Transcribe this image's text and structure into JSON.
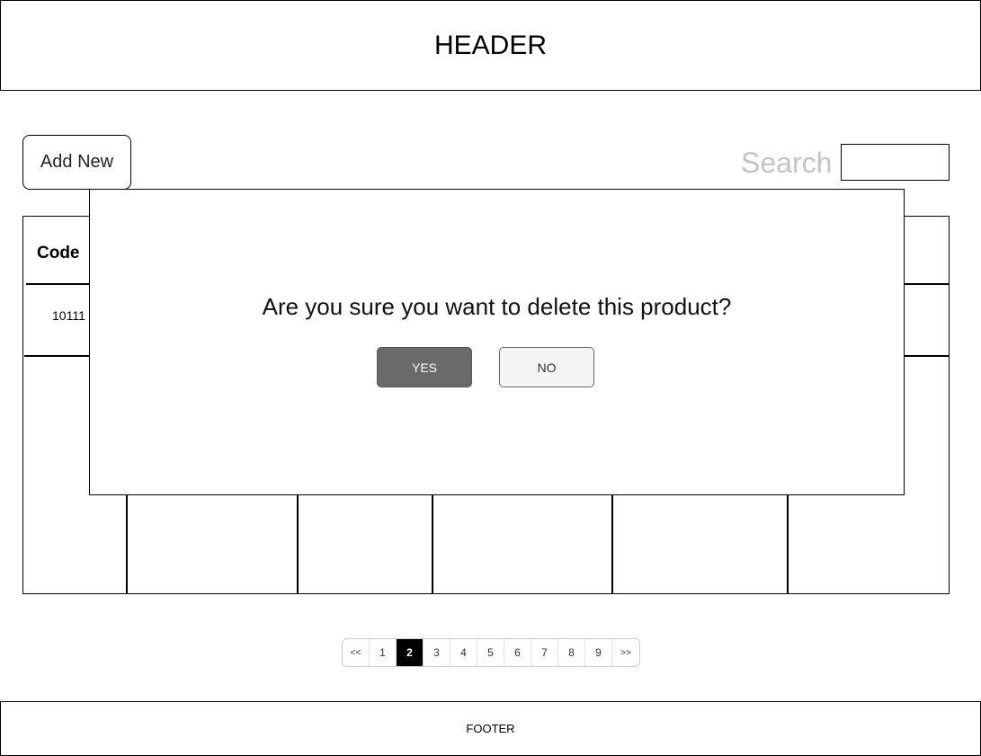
{
  "header": {
    "title": "HEADER"
  },
  "toolbar": {
    "add_new_label": "Add New"
  },
  "search": {
    "label": "Search",
    "value": "",
    "placeholder": ""
  },
  "table": {
    "columns": [
      "Code"
    ],
    "rows": [
      {
        "code": "10111"
      }
    ]
  },
  "dialog": {
    "message": "Are you sure you want to delete this product?",
    "yes_label": "YES",
    "no_label": "NO"
  },
  "pagination": {
    "prev_label": "<<",
    "next_label": ">>",
    "pages": [
      "1",
      "2",
      "3",
      "4",
      "5",
      "6",
      "7",
      "8",
      "9"
    ],
    "current_page": "2"
  },
  "footer": {
    "text": "FOOTER"
  }
}
